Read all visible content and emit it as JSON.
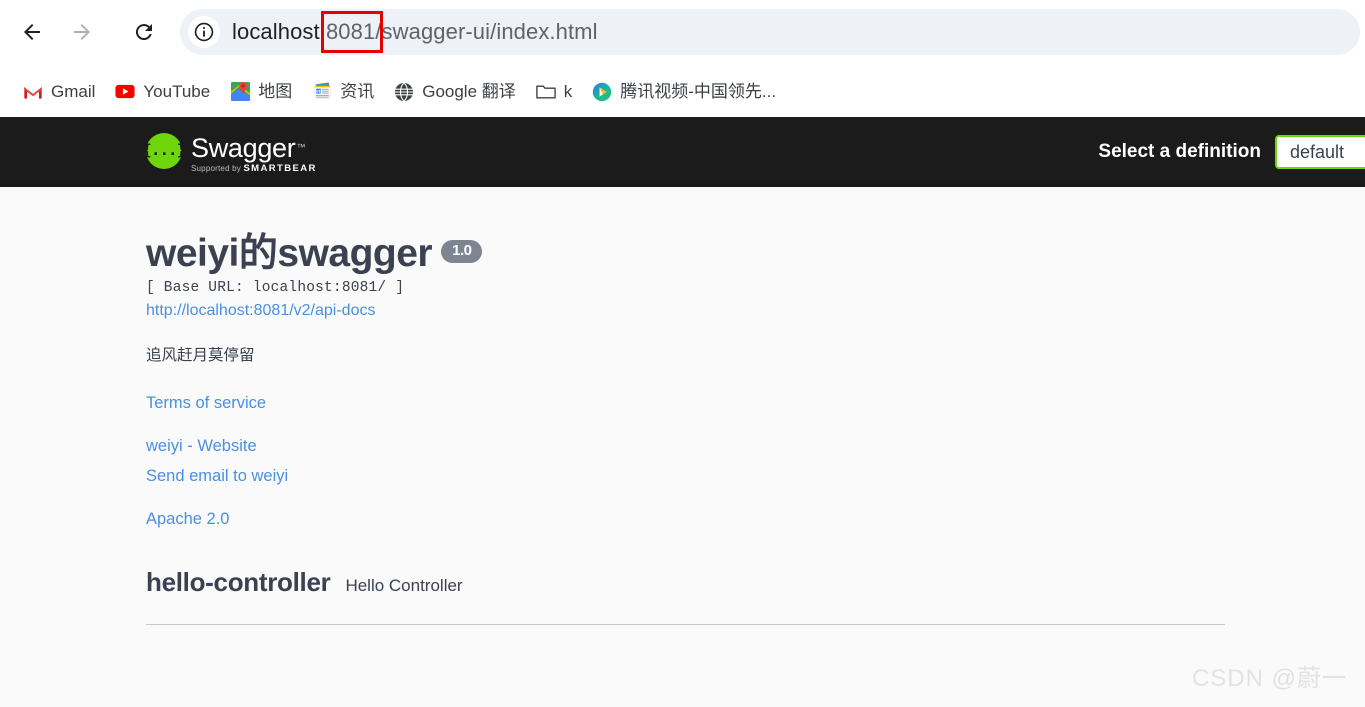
{
  "browser": {
    "nav": {
      "back_icon": "arrow-left-icon",
      "forward_icon": "arrow-right-icon",
      "reload_icon": "reload-icon",
      "site_info_icon": "info-circle-icon"
    },
    "url": {
      "prefix": "localhost",
      "highlighted": ":8081/",
      "suffix": "swagger-ui/index.html",
      "full": "localhost:8081/swagger-ui/index.html"
    },
    "annotation": {
      "color": "#e60000",
      "target": ":8081/"
    },
    "bookmarks": [
      {
        "label": "Gmail",
        "icon": "gmail-icon"
      },
      {
        "label": "YouTube",
        "icon": "youtube-icon"
      },
      {
        "label": "地图",
        "icon": "google-maps-icon"
      },
      {
        "label": "资讯",
        "icon": "google-news-icon"
      },
      {
        "label": "Google 翻译",
        "icon": "google-translate-icon"
      },
      {
        "label": "k",
        "icon": "folder-icon"
      },
      {
        "label": "腾讯视频-中国领先...",
        "icon": "tencent-video-icon"
      }
    ]
  },
  "topbar": {
    "logo_word": "Swagger",
    "logo_tm": "™",
    "logo_glyph": "{...}",
    "supported_by": "Supported by",
    "brand": "SMARTBEAR",
    "select_definition_label": "Select a definition",
    "selected_definition": "default",
    "accent_color": "#6ed60a",
    "background_color": "#1b1b1b"
  },
  "info": {
    "title": "weiyi的swagger",
    "version": "1.0",
    "base_url": "[ Base URL: localhost:8081/ ]",
    "api_docs_url": "http://localhost:8081/v2/api-docs",
    "description": "追风赶月莫停留",
    "links": [
      {
        "label": "Terms of service"
      },
      {
        "label": "weiyi - Website"
      },
      {
        "label": "Send email to weiyi"
      },
      {
        "label": "Apache 2.0"
      }
    ],
    "link_color": "#4990e2"
  },
  "tags": [
    {
      "name": "hello-controller",
      "description": "Hello Controller"
    }
  ],
  "watermark": "CSDN @蔚一"
}
